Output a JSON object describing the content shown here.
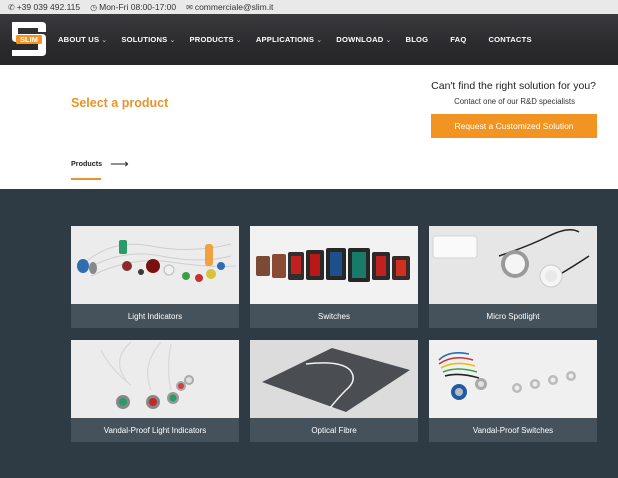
{
  "topbar": {
    "phone": "+39 039 492.115",
    "hours": "Mon-Fri 08:00-17:00",
    "email": "commerciale@slim.it"
  },
  "logo": {
    "text": "SLIM"
  },
  "menu": [
    {
      "label": "ABOUT US",
      "dropdown": true
    },
    {
      "label": "SOLUTIONS",
      "dropdown": true
    },
    {
      "label": "PRODUCTS",
      "dropdown": true
    },
    {
      "label": "APPLICATIONS",
      "dropdown": true
    },
    {
      "label": "DOWNLOAD",
      "dropdown": true
    },
    {
      "label": "BLOG",
      "dropdown": false
    },
    {
      "label": "FAQ",
      "dropdown": false
    },
    {
      "label": "CONTACTS",
      "dropdown": false
    }
  ],
  "hero": {
    "title": "Select a product",
    "cant_find": "Can't find the right solution for you?",
    "contact_line": "Contact one of our R&D specialists",
    "cta": "Request a Customized Solution",
    "products_link": "Products"
  },
  "products": [
    {
      "label": "Light Indicators",
      "icon": "light-indicators-photo"
    },
    {
      "label": "Switches",
      "icon": "switches-photo"
    },
    {
      "label": "Micro Spotlight",
      "icon": "micro-spotlight-photo"
    },
    {
      "label": "Vandal-Proof Light Indicators",
      "icon": "vandal-proof-indicators-photo"
    },
    {
      "label": "Optical Fibre",
      "icon": "optical-fibre-photo"
    },
    {
      "label": "Vandal-Proof Switches",
      "icon": "vandal-proof-switches-photo"
    }
  ],
  "colors": {
    "accent": "#f29421",
    "title_orange": "#e8942a",
    "nav_bg": "#2b2b2e",
    "section_bg": "#2e3a44",
    "card_label_bg": "#45525b"
  }
}
